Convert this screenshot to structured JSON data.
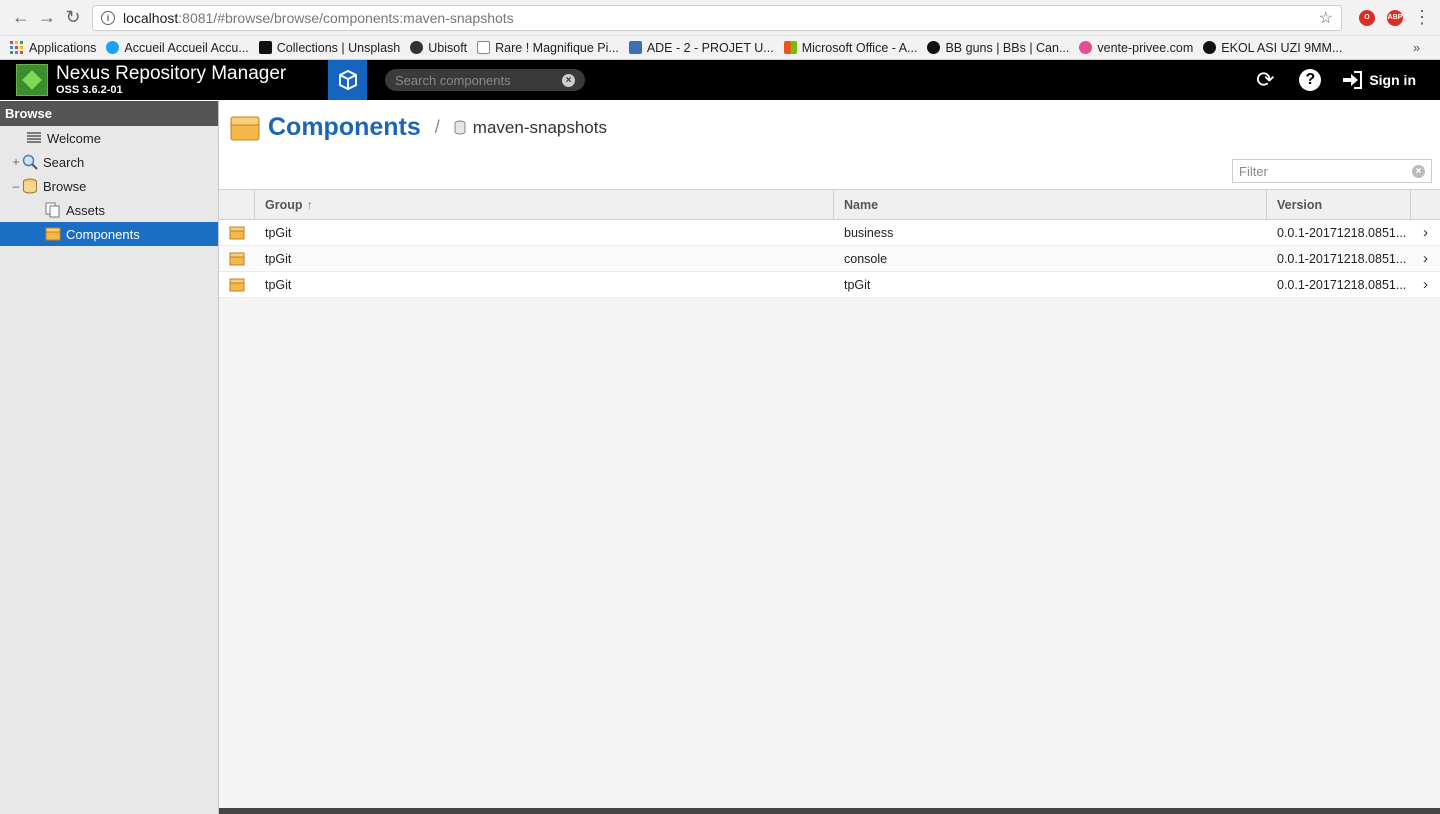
{
  "browser": {
    "url_host": "localhost",
    "url_path": ":8081/#browse/browse/components:maven-snapshots",
    "bookmarks": [
      {
        "label": "Applications",
        "icon": "apps-grid-icon"
      },
      {
        "label": "Accueil Accueil Accu...",
        "icon": "twitter-icon"
      },
      {
        "label": "Collections | Unsplash",
        "icon": "camera-icon"
      },
      {
        "label": "Ubisoft",
        "icon": "apple-icon"
      },
      {
        "label": "Rare ! Magnifique Pi...",
        "icon": "page-icon"
      },
      {
        "label": "ADE - 2 - PROJET U...",
        "icon": "ade-icon"
      },
      {
        "label": "Microsoft Office - A...",
        "icon": "microsoft-icon"
      },
      {
        "label": "BB guns | BBs | Can...",
        "icon": "r-logo-icon"
      },
      {
        "label": "vente-privee.com",
        "icon": "vente-privee-icon"
      },
      {
        "label": "EKOL ASI UZI 9MM...",
        "icon": "r-logo-icon"
      }
    ],
    "more_label": "»"
  },
  "header": {
    "title": "Nexus Repository Manager",
    "version": "OSS 3.6.2-01",
    "search_placeholder": "Search components",
    "signin_label": "Sign in"
  },
  "sidebar": {
    "heading": "Browse",
    "items": [
      {
        "label": "Welcome"
      },
      {
        "label": "Search",
        "expander": "+"
      },
      {
        "label": "Browse",
        "expander": "–"
      },
      {
        "label": "Assets"
      },
      {
        "label": "Components"
      }
    ]
  },
  "main": {
    "title": "Components",
    "separator": "/",
    "repository": "maven-snapshots",
    "filter_placeholder": "Filter",
    "columns": {
      "group": "Group",
      "name": "Name",
      "version": "Version"
    },
    "rows": [
      {
        "group": "tpGit",
        "name": "business",
        "version": "0.0.1-20171218.0851..."
      },
      {
        "group": "tpGit",
        "name": "console",
        "version": "0.0.1-20171218.0851..."
      },
      {
        "group": "tpGit",
        "name": "tpGit",
        "version": "0.0.1-20171218.0851..."
      }
    ]
  },
  "colors": {
    "accent": "#1a6fc4",
    "title_blue": "#1c67b5",
    "header_bg": "#000000"
  }
}
